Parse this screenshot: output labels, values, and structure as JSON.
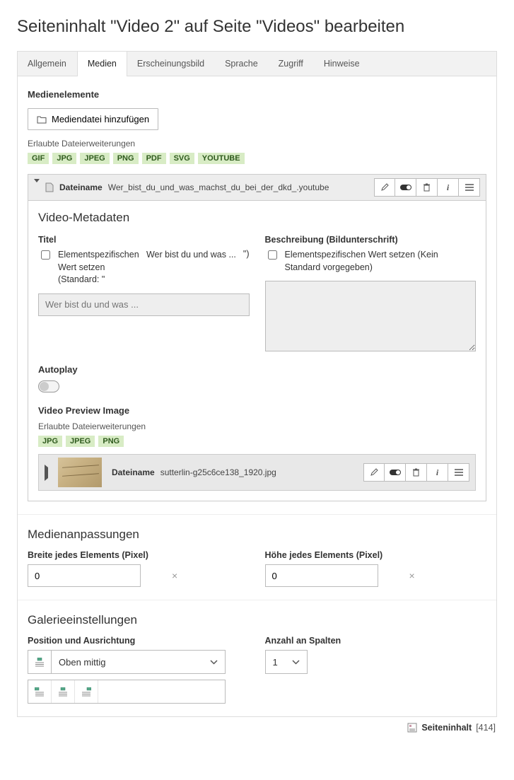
{
  "page": {
    "title": "Seiteninhalt \"Video 2\" auf Seite \"Videos\" bearbeiten"
  },
  "tabs": {
    "t0": "Allgemein",
    "t1": "Medien",
    "t2": "Erscheinungsbild",
    "t3": "Sprache",
    "t4": "Zugriff",
    "t5": "Hinweise"
  },
  "media": {
    "heading": "Medienelemente",
    "add_button": "Mediendatei hinzufügen",
    "ext_note": "Erlaubte Dateierweiterungen",
    "ext": {
      "e0": "GIF",
      "e1": "JPG",
      "e2": "JPEG",
      "e3": "PNG",
      "e4": "PDF",
      "e5": "SVG",
      "e6": "YOUTUBE"
    },
    "file1": {
      "label": "Dateiname",
      "name": "Wer_bist_du_und_was_machst_du_bei_der_dkd_.youtube"
    },
    "meta": {
      "heading": "Video-Metadaten",
      "titel_label": "Titel",
      "titel_check": "Elementspezifischen Wert setzen (Standard: \"",
      "titel_default": "Wer bist du und was ...",
      "titel_close": "\")",
      "titel_placeholder": "Wer bist du und was ...",
      "desc_label": "Beschreibung (Bildunterschrift)",
      "desc_check": "Elementspezifischen Wert setzen (Kein Standard vorgegeben)",
      "autoplay_label": "Autoplay",
      "preview_label": "Video Preview Image",
      "preview_ext_note": "Erlaubte Dateierweiterungen",
      "preview_ext": {
        "e0": "JPG",
        "e1": "JPEG",
        "e2": "PNG"
      },
      "preview_file_label": "Dateiname",
      "preview_file_name": "sutterlin-g25c6ce138_1920.jpg"
    }
  },
  "adjust": {
    "heading": "Medienanpassungen",
    "width_label": "Breite jedes Elements (Pixel)",
    "width_value": "0",
    "height_label": "Höhe jedes Elements (Pixel)",
    "height_value": "0"
  },
  "gallery": {
    "heading": "Galerieeinstellungen",
    "pos_label": "Position und Ausrichtung",
    "pos_value": "Oben mittig",
    "cols_label": "Anzahl an Spalten",
    "cols_value": "1"
  },
  "footer": {
    "label": "Seiteninhalt",
    "uid": "[414]"
  }
}
